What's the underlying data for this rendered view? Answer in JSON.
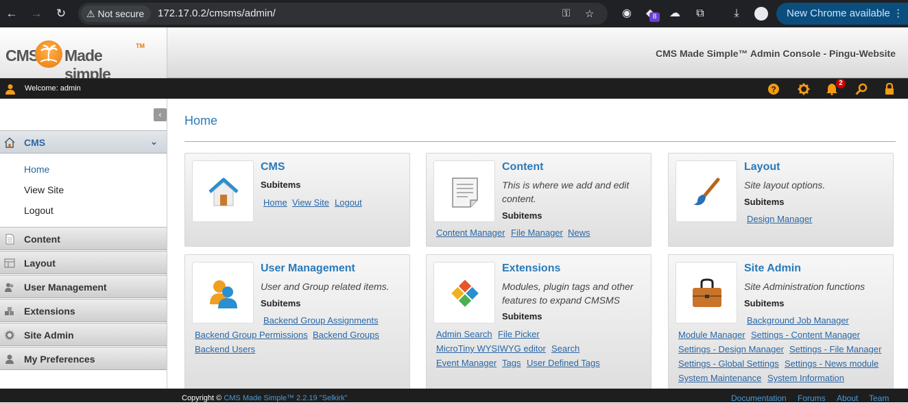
{
  "browser": {
    "security_label": "Not secure",
    "url": "172.17.0.2/cmsms/admin/",
    "extension_badge": "8",
    "update_button": "New Chrome available"
  },
  "header": {
    "logo_cms": "CMS",
    "logo_made_simple": "Made simple",
    "logo_tm": "TM",
    "console_title": "CMS Made Simple™ Admin Console - Pingu-Website"
  },
  "userbar": {
    "welcome": "Welcome: admin",
    "notification_count": "2",
    "icons": [
      "help-icon",
      "settings-icon",
      "notifications-icon",
      "search-icon",
      "logout-lock-icon"
    ]
  },
  "sidebar": {
    "sections": [
      {
        "label": "CMS",
        "icon": "home-icon",
        "active": true,
        "children": [
          "Home",
          "View Site",
          "Logout"
        ]
      },
      {
        "label": "Content",
        "icon": "content-icon"
      },
      {
        "label": "Layout",
        "icon": "layout-icon"
      },
      {
        "label": "User Management",
        "icon": "users-icon"
      },
      {
        "label": "Extensions",
        "icon": "extensions-icon"
      },
      {
        "label": "Site Admin",
        "icon": "site-admin-icon"
      },
      {
        "label": "My Preferences",
        "icon": "preferences-icon"
      }
    ]
  },
  "main": {
    "title": "Home",
    "subitems_label": "Subitems",
    "panels": [
      {
        "title": "CMS",
        "description": "",
        "links": [
          "Home",
          "View Site",
          "Logout"
        ]
      },
      {
        "title": "Content",
        "description": "This is where we add and edit content.",
        "links": [
          "Content Manager",
          "File Manager",
          "News"
        ]
      },
      {
        "title": "Layout",
        "description": "Site layout options.",
        "links": [
          "Design Manager"
        ]
      },
      {
        "title": "User Management",
        "description": "User and Group related items.",
        "links": [
          "Backend Group Assignments",
          "Backend Group Permissions",
          "Backend Groups",
          "Backend Users"
        ]
      },
      {
        "title": "Extensions",
        "description": "Modules, plugin tags and other features to expand CMSMS",
        "links": [
          "Admin Search",
          "File Picker",
          "MicroTiny WYSIWYG editor",
          "Search",
          "Event Manager",
          "Tags",
          "User Defined Tags"
        ]
      },
      {
        "title": "Site Admin",
        "description": "Site Administration functions",
        "links": [
          "Background Job Manager",
          "Module Manager",
          "Settings - Content Manager",
          "Settings - Design Manager",
          "Settings - File Manager",
          "Settings - Global Settings",
          "Settings - News module",
          "System Maintenance",
          "System Information"
        ]
      }
    ]
  },
  "footer": {
    "copyright_prefix": "Copyright ©",
    "copyright_link": "CMS Made Simple™ 2.2.19 \"Selkirk\"",
    "links": [
      "Documentation",
      "Forums",
      "About",
      "Team"
    ]
  },
  "colors": {
    "accent": "#2a7ab8",
    "orange": "#e8780a",
    "rule": "#e0a030"
  }
}
